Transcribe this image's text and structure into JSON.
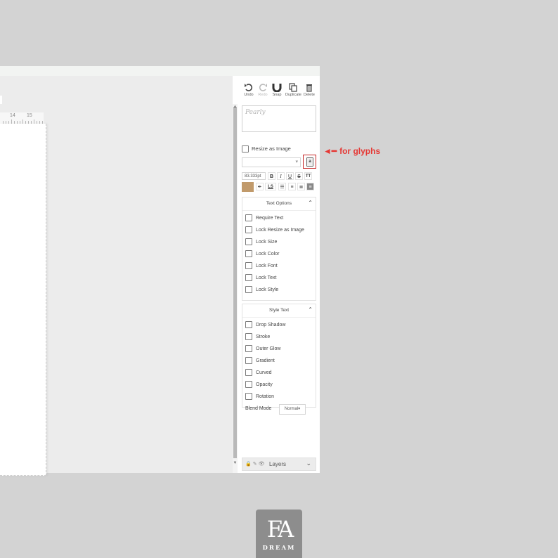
{
  "toolbar": {
    "undo": "Undo",
    "redo": "Redo",
    "snap": "Snap",
    "duplicate": "Duplicate",
    "delete": "Delete"
  },
  "preview_text": "Pearly",
  "resize_as_image": "Resize as Image",
  "font_size": "83.333pt",
  "format": {
    "bold": "B",
    "italic": "I",
    "underline": "U",
    "strike": "S",
    "caps": "TT",
    "letter_spacing": "LS",
    "swatch_color": "#c19a6b"
  },
  "text_options": {
    "title": "Text Options",
    "items": [
      "Require Text",
      "Lock Resize as Image",
      "Lock Size",
      "Lock Color",
      "Lock Font",
      "Lock Text",
      "Lock Style"
    ]
  },
  "style_text": {
    "title": "Style Text",
    "items": [
      "Drop Shadow",
      "Stroke",
      "Outer Glow",
      "Gradient",
      "Curved",
      "Opacity",
      "Rotation"
    ],
    "blend_label": "Blend Mode",
    "blend_value": "Normal"
  },
  "layers": "Layers",
  "ruler": {
    "n1": "14",
    "n2": "15"
  },
  "annotation": "for glyphs",
  "logo": {
    "word": "DREAM"
  }
}
